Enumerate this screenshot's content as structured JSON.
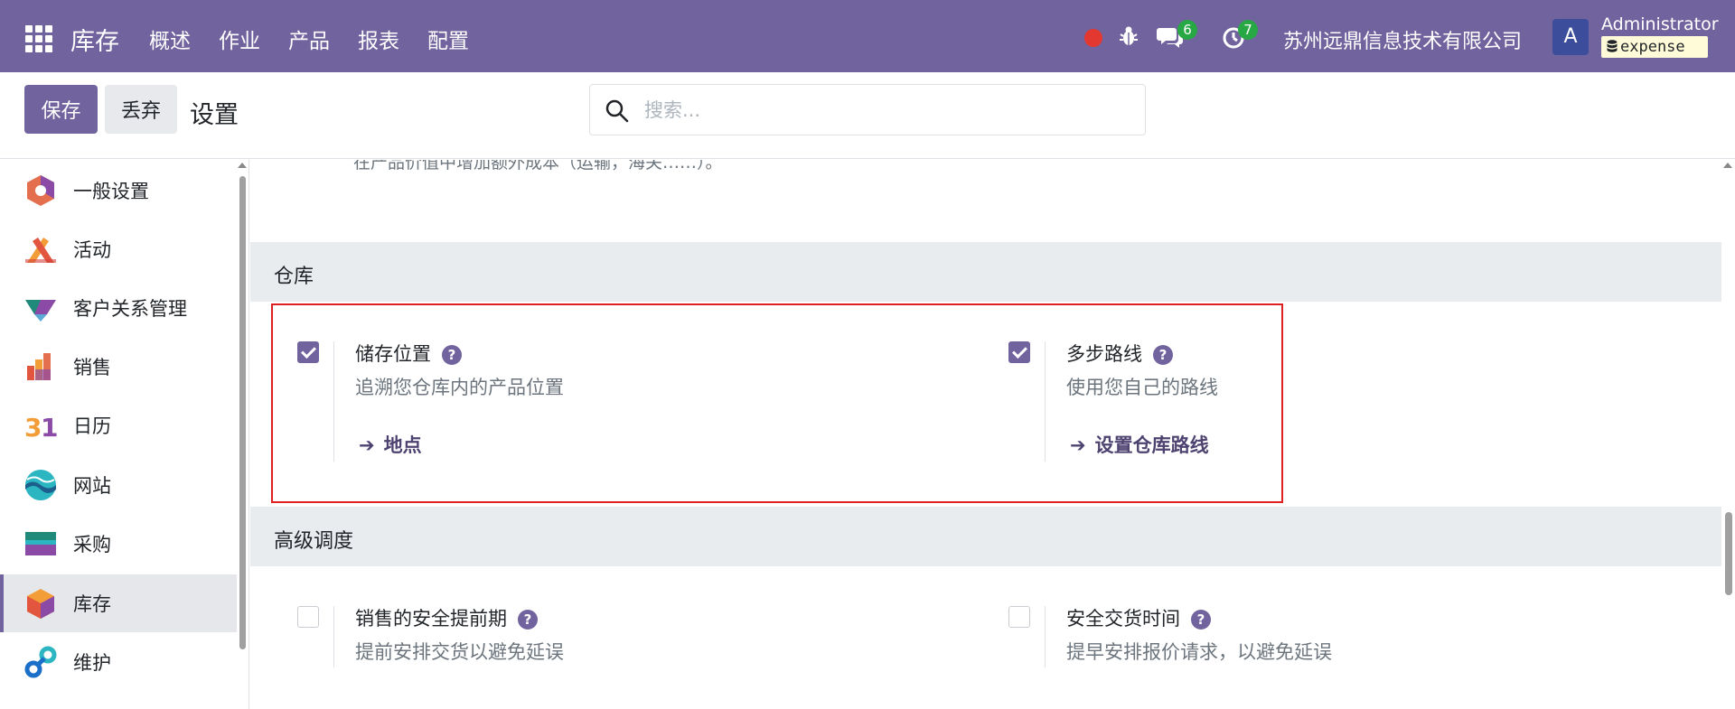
{
  "navbar": {
    "app_name": "库存",
    "menu": [
      "概述",
      "作业",
      "产品",
      "报表",
      "配置"
    ],
    "messages_count": "6",
    "activities_count": "7",
    "company": "苏州远鼎信息技术有限公司",
    "avatar_letter": "A",
    "user_name": "Administrator",
    "database": "expense",
    "colors": {
      "navbar_bg": "#71639e",
      "recording": "#e2382f",
      "badge": "#28a745"
    }
  },
  "control_panel": {
    "save_label": "保存",
    "discard_label": "丢弃",
    "title": "设置",
    "search_placeholder": "搜索..."
  },
  "sidebar": {
    "items": [
      {
        "label": "一般设置",
        "icon": "general-settings-icon",
        "active": false
      },
      {
        "label": "活动",
        "icon": "activity-icon",
        "active": false
      },
      {
        "label": "客户关系管理",
        "icon": "crm-icon",
        "active": false
      },
      {
        "label": "销售",
        "icon": "sales-icon",
        "active": false
      },
      {
        "label": "日历",
        "icon": "calendar-icon",
        "active": false
      },
      {
        "label": "网站",
        "icon": "website-icon",
        "active": false
      },
      {
        "label": "采购",
        "icon": "purchase-icon",
        "active": false
      },
      {
        "label": "库存",
        "icon": "inventory-icon",
        "active": true
      },
      {
        "label": "维护",
        "icon": "maintenance-icon",
        "active": false
      }
    ]
  },
  "main": {
    "clipped_text": "在产品价值中增加额外成本（运输，海关……）。",
    "sections": [
      {
        "title": "仓库",
        "settings": [
          {
            "title": "储存位置",
            "description": "追溯您仓库内的产品位置",
            "link": "地点",
            "checked": true
          },
          {
            "title": "多步路线",
            "description": "使用您自己的路线",
            "link": "设置仓库路线",
            "checked": true
          }
        ]
      },
      {
        "title": "高级调度",
        "settings": [
          {
            "title": "销售的安全提前期",
            "description": "提前安排交货以避免延误",
            "checked": false
          },
          {
            "title": "安全交货时间",
            "description": "提早安排报价请求，以避免延误",
            "checked": false
          }
        ]
      }
    ],
    "highlight_color": "#e02020"
  }
}
